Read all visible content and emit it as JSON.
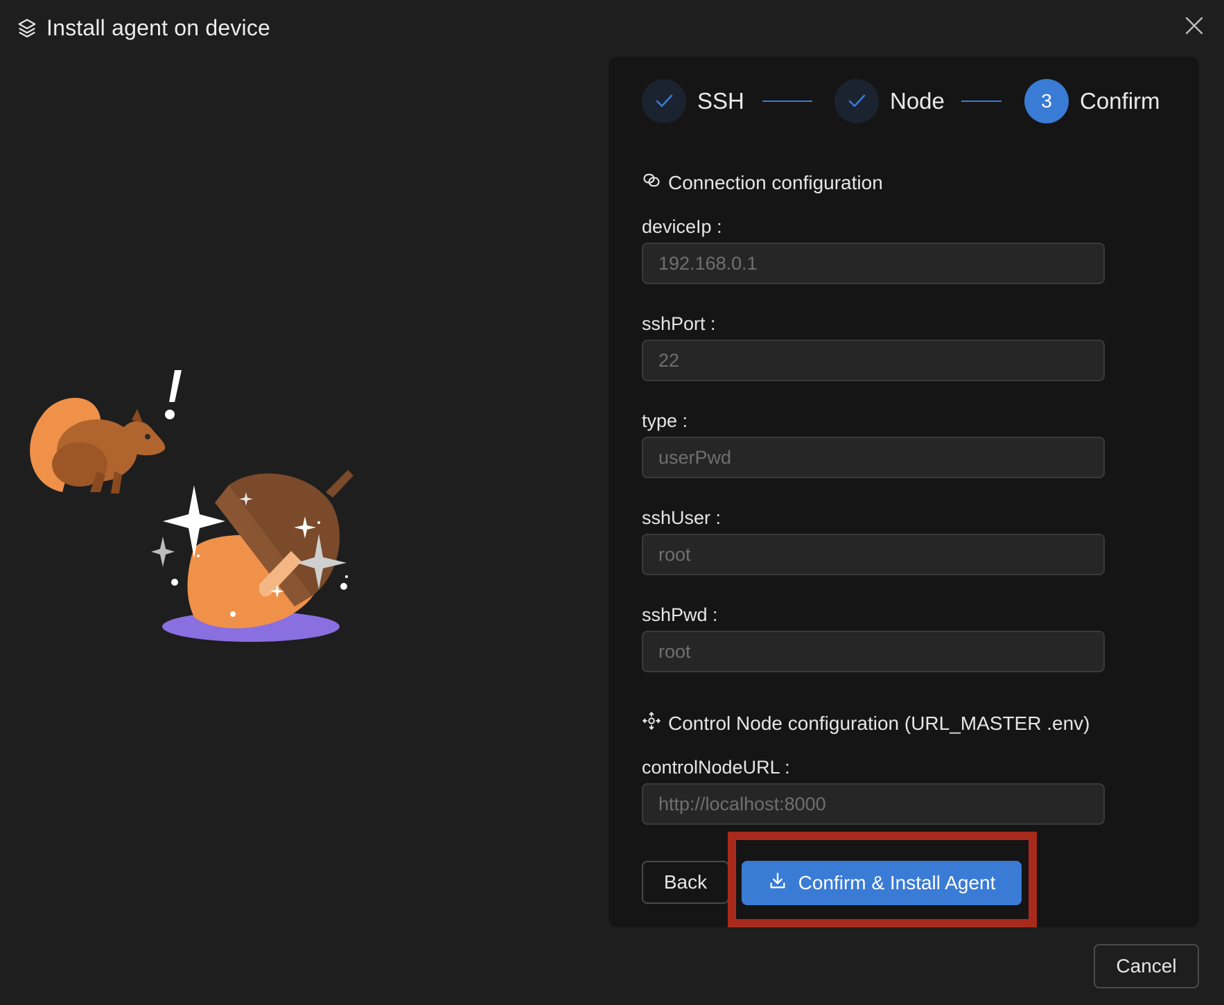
{
  "dialog": {
    "title": "Install agent on device",
    "close_icon": "close-icon",
    "header_icon": "package-icon"
  },
  "stepper": {
    "steps": [
      {
        "label": "SSH",
        "status": "done",
        "icon": "check-icon"
      },
      {
        "label": "Node",
        "status": "done",
        "icon": "check-icon"
      },
      {
        "label": "Confirm",
        "status": "active",
        "number": "3"
      }
    ],
    "accent_color": "#3a7bd5"
  },
  "connection": {
    "section_title": "Connection configuration",
    "icon": "link-icon",
    "fields": [
      {
        "label": "deviceIp :",
        "placeholder": "192.168.0.1"
      },
      {
        "label": "sshPort :",
        "placeholder": "22"
      },
      {
        "label": "type :",
        "placeholder": "userPwd"
      },
      {
        "label": "sshUser :",
        "placeholder": "root"
      },
      {
        "label": "sshPwd :",
        "placeholder": "root"
      }
    ]
  },
  "control_node": {
    "section_title": "Control Node configuration (URL_MASTER .env)",
    "icon": "node-icon",
    "fields": [
      {
        "label": "controlNodeURL :",
        "placeholder": "http://localhost:8000"
      }
    ]
  },
  "actions": {
    "back_label": "Back",
    "confirm_label": "Confirm & Install Agent",
    "confirm_icon": "download-icon",
    "cancel_label": "Cancel"
  },
  "illustration": "squirrel-acorn-illustration",
  "highlight_color": "#a82a1c"
}
